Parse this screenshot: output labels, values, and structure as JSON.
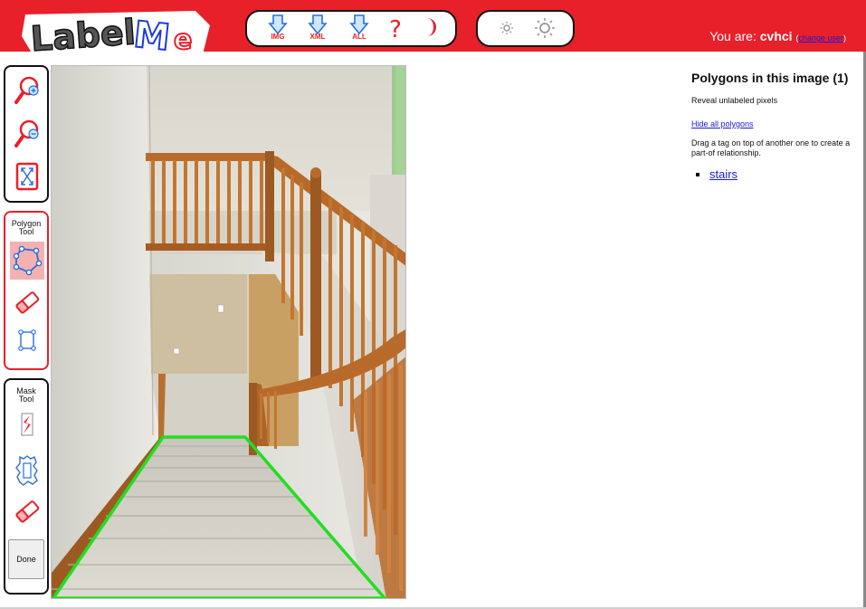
{
  "header": {
    "logo_text": "LabelMe",
    "buttons": [
      {
        "name": "download-img-button",
        "caption": "IMG",
        "icon": "download-arrow-icon"
      },
      {
        "name": "download-xml-button",
        "caption": "XML",
        "icon": "download-arrow-icon"
      },
      {
        "name": "download-all-button",
        "caption": "ALL",
        "icon": "download-arrow-icon"
      },
      {
        "name": "help-button",
        "caption": "",
        "icon": "question-mark-icon"
      },
      {
        "name": "night-mode-button",
        "caption": "",
        "icon": "moon-icon"
      }
    ],
    "brightness_buttons": [
      {
        "name": "brightness-down-button",
        "icon": "sun-small-icon"
      },
      {
        "name": "brightness-up-button",
        "icon": "sun-large-icon"
      }
    ],
    "user_prefix": "You are:",
    "username": "cvhci",
    "change_user_open": "(",
    "change_user_label": "change user",
    "change_user_close": ")"
  },
  "toolbars": {
    "zoom": [
      {
        "name": "zoom-in-icon"
      },
      {
        "name": "zoom-out-icon"
      },
      {
        "name": "fit-to-screen-icon"
      }
    ],
    "polygon": {
      "title_line1": "Polygon",
      "title_line2": "Tool",
      "tools": [
        {
          "name": "polygon-tool-icon",
          "active": true
        },
        {
          "name": "eraser-icon",
          "active": false
        },
        {
          "name": "bounding-box-icon",
          "active": false
        }
      ]
    },
    "mask": {
      "title_line1": "Mask",
      "title_line2": "Tool",
      "tools": [
        {
          "name": "mask-brush-icon"
        },
        {
          "name": "mask-segment-icon"
        },
        {
          "name": "mask-eraser-icon"
        }
      ],
      "done_label": "Done"
    }
  },
  "canvas": {
    "polygon_color": "#22dd22",
    "polygon_label": "stairs"
  },
  "panel": {
    "title": "Polygons in this image (1)",
    "reveal_text": "Reveal unlabeled pixels",
    "hide_link": "Hide all polygons",
    "drag_hint": "Drag a tag on top of another one to create a part-of relationship.",
    "polygons": [
      "stairs"
    ]
  },
  "colors": {
    "header_red": "#e8202a",
    "link_blue": "#1a1ad8",
    "wood": "#b86a2a"
  }
}
